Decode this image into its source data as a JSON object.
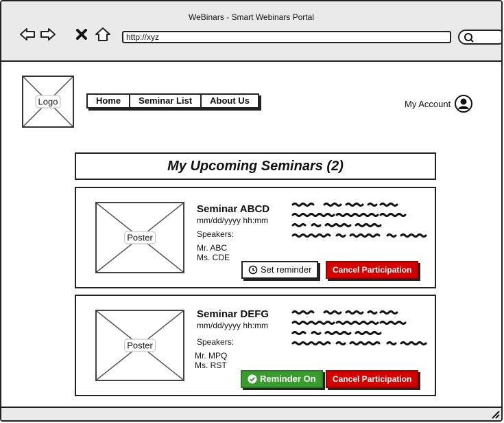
{
  "window": {
    "title": "WeBinars - Smart Webinars Portal",
    "url": "http://xyz"
  },
  "header": {
    "logo_label": "Logo",
    "menu": [
      "Home",
      "Seminar List",
      "About Us"
    ],
    "account_label": "My Account"
  },
  "main": {
    "heading": "My Upcoming Seminars (2)",
    "seminars": [
      {
        "poster_label": "Poster",
        "title": "Seminar ABCD",
        "datetime": "mm/dd/yyyy hh:mm",
        "speakers_label": "Speakers:",
        "speakers": [
          "Mr. ABC",
          "Ms. CDE"
        ],
        "reminder_label": "Set reminder",
        "reminder_state": "off",
        "cancel_label": "Cancel Participation"
      },
      {
        "poster_label": "Poster",
        "title": "Seminar DEFG",
        "datetime": "mm/dd/yyyy hh:mm",
        "speakers_label": "Speakers:",
        "speakers": [
          "Mr. MPQ",
          "Ms. RST"
        ],
        "reminder_label": "Reminder On",
        "reminder_state": "on",
        "cancel_label": "Cancel Participation"
      }
    ]
  },
  "colors": {
    "cancel": "#d40000",
    "reminder_on": "#3a9b2f"
  },
  "icons": [
    "back-arrow-icon",
    "forward-arrow-icon",
    "close-icon",
    "home-icon",
    "search-icon",
    "user-icon",
    "clock-icon",
    "check-circle-icon"
  ]
}
